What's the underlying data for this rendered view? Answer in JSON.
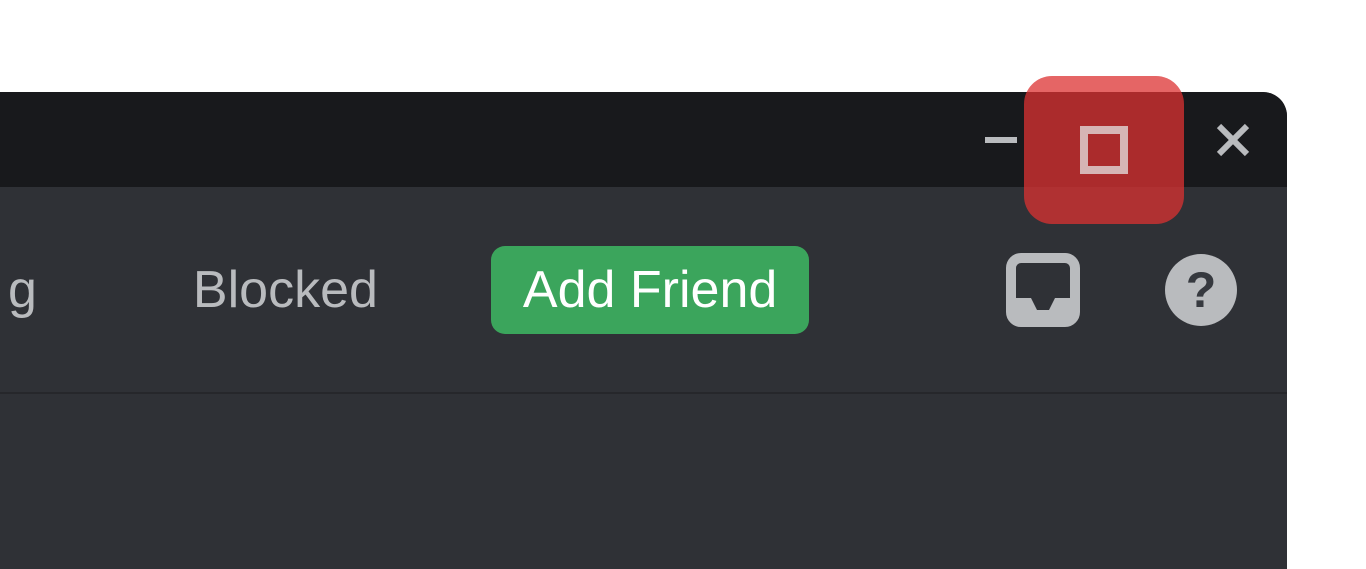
{
  "window_controls": {
    "minimize_icon": "minimize-icon",
    "maximize_icon": "maximize-icon",
    "close_icon": "close-icon"
  },
  "toolbar": {
    "tab_partial": "g",
    "tab_blocked": "Blocked",
    "add_friend_label": "Add Friend",
    "inbox_icon": "inbox-icon",
    "help_icon": "help-icon",
    "help_text": "?"
  },
  "annotation": {
    "highlight_target": "maximize-button"
  }
}
